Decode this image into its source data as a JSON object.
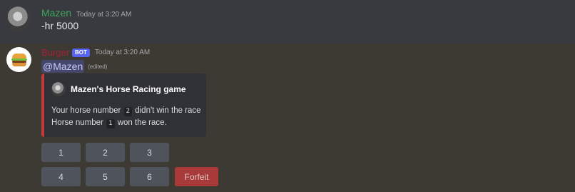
{
  "messages": {
    "user": {
      "username": "Mazen",
      "timestamp": "Today at 3:20 AM",
      "content": "-hr 5000"
    },
    "bot": {
      "username": "Burger",
      "badge": "BOT",
      "timestamp": "Today at 3:20 AM",
      "mention": "@Mazen",
      "edited": "(edited)",
      "embed": {
        "author": "Mazen's Horse Racing game",
        "line1_prefix": "Your horse number",
        "line1_code": "2",
        "line1_suffix": "didn't win the race",
        "line2_prefix": "Horse number",
        "line2_code": "1",
        "line2_suffix": "won the race."
      },
      "buttons": {
        "b1": "1",
        "b2": "2",
        "b3": "3",
        "b4": "4",
        "b5": "5",
        "b6": "6",
        "forfeit": "Forfeit"
      }
    }
  },
  "colors": {
    "user_name": "#3ba55c",
    "bot_name": "#a3213a",
    "bot_badge": "#5865f2",
    "embed_border": "#c33a3a",
    "forfeit_button": "#a83a3a"
  },
  "icons": {
    "user_avatar": "user-avatar-photo",
    "bot_avatar": "burger-icon"
  }
}
